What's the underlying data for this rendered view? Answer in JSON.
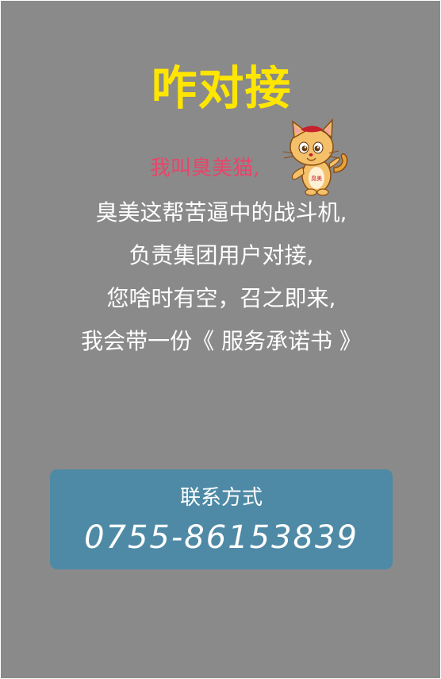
{
  "header": {
    "title": "咋对接"
  },
  "intro": {
    "line": "我叫臭美猫,",
    "mascot": {
      "icon": "cat-mascot-icon",
      "badge_text": "臭美"
    }
  },
  "message": {
    "lines": [
      "臭美这帮苦逼中的战斗机,",
      "负责集团用户对接,",
      "您啥时有空，召之即来,",
      "我会带一份《 服务承诺书 》"
    ]
  },
  "contact": {
    "label": "联系方式",
    "phone": "0755-86153839"
  },
  "colors": {
    "background": "#8a8a8a",
    "title": "#ffe600",
    "intro": "#e8456a",
    "card": "#4e8aa6",
    "text": "#ffffff"
  }
}
